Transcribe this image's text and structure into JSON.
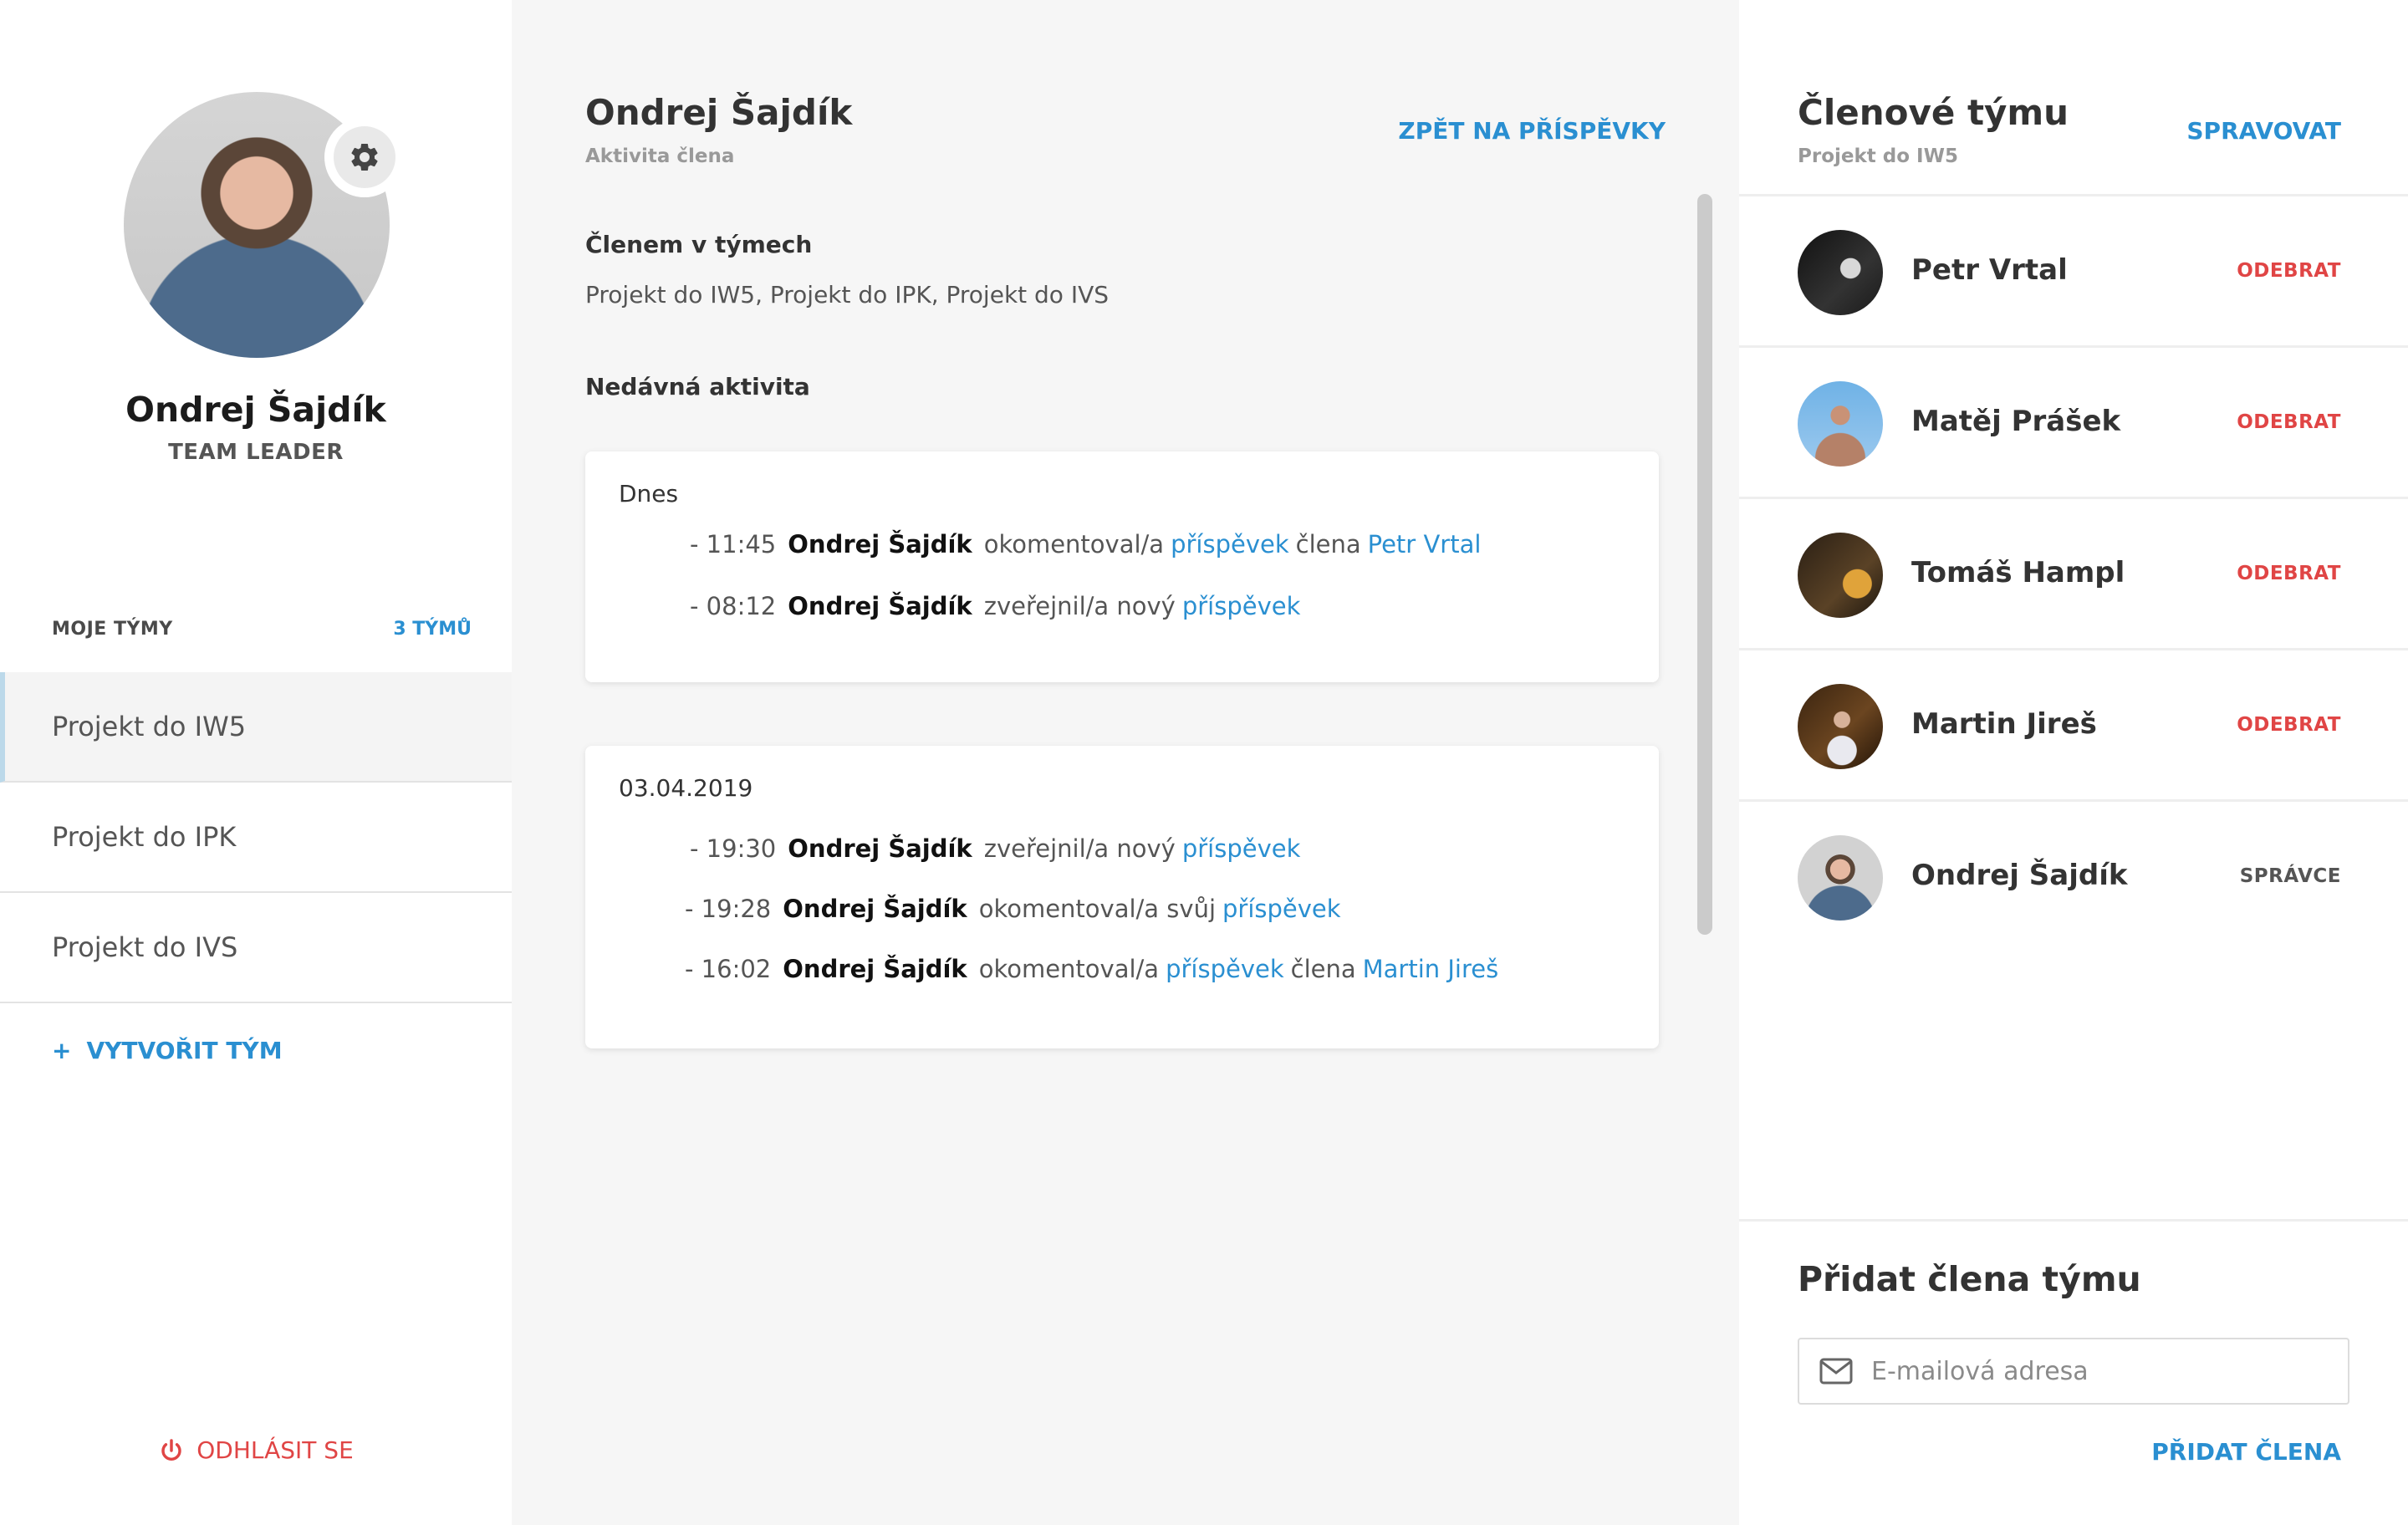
{
  "sidebar": {
    "user_name": "Ondrej Šajdík",
    "user_role": "TEAM LEADER",
    "teams_label": "MOJE TÝMY",
    "teams_count": "3 TÝMŮ",
    "teams": [
      {
        "label": "Projekt do IW5",
        "active": true
      },
      {
        "label": "Projekt do IPK",
        "active": false
      },
      {
        "label": "Projekt do IVS",
        "active": false
      }
    ],
    "create_team": "VYTVOŘIT TÝM",
    "create_team_icon": "plus-icon",
    "logout": "ODHLÁSIT SE",
    "logout_icon": "power-icon"
  },
  "main": {
    "title": "Ondrej Šajdík",
    "subtitle": "Aktivita člena",
    "back_link": "ZPĚT NA PŘÍSPĚVKY",
    "member_of_title": "Členem v týmech",
    "member_of_text": "Projekt do IW5, Projekt do IPK, Projekt do IVS",
    "recent_title": "Nedávná aktivita",
    "groups": [
      {
        "date": "Dnes",
        "items": [
          {
            "time": "-  11:45",
            "who": "Ondrej Šajdík",
            "text": "okomentoval/a",
            "link": "příspěvek",
            "text2": "člena",
            "link2": "Petr Vrtal"
          },
          {
            "time": "- 08:12",
            "who": "Ondrej Šajdík",
            "text": "zveřejnil/a nový",
            "link": "příspěvek",
            "text2": "",
            "link2": ""
          }
        ]
      },
      {
        "date": "03.04.2019",
        "items": [
          {
            "time": "- 19:30",
            "who": "Ondrej Šajdík",
            "text": "zveřejnil/a nový",
            "link": "příspěvek",
            "text2": "",
            "link2": ""
          },
          {
            "time": "- 19:28",
            "who": "Ondrej Šajdík",
            "text": "okomentoval/a svůj",
            "link": "příspěvek",
            "text2": "",
            "link2": ""
          },
          {
            "time": "- 16:02",
            "who": "Ondrej Šajdík",
            "text": "okomentoval/a",
            "link": "příspěvek",
            "text2": "člena",
            "link2": "Martin Jireš"
          }
        ]
      }
    ]
  },
  "right": {
    "title": "Členové týmu",
    "subtitle": "Projekt do IW5",
    "manage": "SPRAVOVAT",
    "members": [
      {
        "name": "Petr Vrtal",
        "action": "ODEBRAT",
        "kind": "remove"
      },
      {
        "name": "Matěj Prášek",
        "action": "ODEBRAT",
        "kind": "remove"
      },
      {
        "name": "Tomáš Hampl",
        "action": "ODEBRAT",
        "kind": "remove"
      },
      {
        "name": "Martin Jireš",
        "action": "ODEBRAT",
        "kind": "remove"
      },
      {
        "name": "Ondrej Šajdík",
        "action": "SPRÁVCE",
        "kind": "admin"
      }
    ],
    "add_title": "Přidat člena týmu",
    "email_placeholder": "E-mailová adresa",
    "email_icon": "envelope-icon",
    "add_button": "PŘIDAT ČLENA"
  },
  "colors": {
    "accent": "#2a8fd1",
    "danger": "#e04545",
    "background": "#f6f6f6"
  }
}
